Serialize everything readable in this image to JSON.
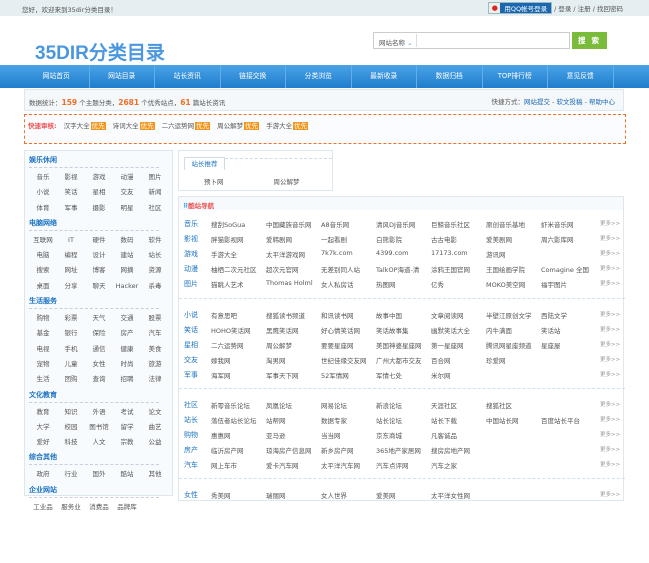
{
  "topbar": {
    "welcome": "您好，欢迎来到35dir分类目录！",
    "qq_login": "用QQ帐号登录",
    "links": "/ 登录 / 注册 / 找回密码"
  },
  "logo": "35DIR分类目录",
  "search": {
    "select": "网站名称",
    "button": "搜 索",
    "placeholder": ""
  },
  "nav": [
    "网站首页",
    "网站目录",
    "站长资讯",
    "链接交换",
    "分类浏览",
    "最新收录",
    "数据归档",
    "TOP排行榜",
    "意见反馈"
  ],
  "stats": {
    "prefix": "数据统计：",
    "categories": "159",
    "cat_text": "个主题分类，",
    "sites": "2681",
    "sites_text": "个优秀站点，",
    "news": "61",
    "news_text": "篇站长资讯",
    "quick_label": "快捷方式：",
    "quick_links": [
      "网站提交",
      "软文投稿",
      "帮助中心"
    ],
    "sep": " - "
  },
  "fast_review": {
    "title": "快速审核:",
    "tag": "优先",
    "items": [
      "汉字大全",
      "诗词大全",
      "二六运势网",
      "周公解梦",
      "手游大全"
    ]
  },
  "sidebar": [
    {
      "title": "娱乐休闲",
      "items": [
        "音乐",
        "影视",
        "游戏",
        "动漫",
        "图片",
        "小说",
        "笑话",
        "星相",
        "交友",
        "新闻",
        "体育",
        "军事",
        "摄影",
        "明星",
        "社区"
      ]
    },
    {
      "title": "电脑网络",
      "items": [
        "互联网",
        "IT",
        "硬件",
        "数码",
        "软件",
        "电脑",
        "编程",
        "设计",
        "建站",
        "站长",
        "搜索",
        "网址",
        "博客",
        "网摘",
        "资源",
        "桌面",
        "分享",
        "聊天",
        "Hacker",
        "杀毒"
      ]
    },
    {
      "title": "生活服务",
      "items": [
        "购物",
        "彩票",
        "天气",
        "交通",
        "股票",
        "基金",
        "银行",
        "保险",
        "房产",
        "汽车",
        "电视",
        "手机",
        "通信",
        "健康",
        "美食",
        "宠物",
        "儿童",
        "女性",
        "时尚",
        "旅游",
        "生活",
        "团购",
        "查询",
        "招聘",
        "法律"
      ]
    },
    {
      "title": "文化教育",
      "items": [
        "教育",
        "知识",
        "外语",
        "考试",
        "论文",
        "大学",
        "校园",
        "图书馆",
        "留学",
        "曲艺",
        "爱好",
        "科技",
        "人文",
        "宗教",
        "公益"
      ]
    },
    {
      "title": "综合其他",
      "items": [
        "政府",
        "行业",
        "国外",
        "酷站",
        "其他"
      ]
    },
    {
      "title": "企业网站",
      "items": [
        "工业品",
        "服务业",
        "消费品",
        "品牌库"
      ]
    }
  ],
  "recommend": {
    "title": "站长推荐",
    "items": [
      "预卜网",
      "周公解梦"
    ]
  },
  "site_nav": {
    "title": "酷站导航",
    "more": "更多>>",
    "groups": [
      [
        {
          "label": "音乐",
          "sites": [
            "搜刮SoGua",
            "中国藏族音乐网",
            "A8音乐网",
            "清风DJ音乐网",
            "巨鲸音乐社区",
            "原创音乐基地",
            "虾米音乐网"
          ]
        },
        {
          "label": "影视",
          "sites": [
            "胖猫影视网",
            "爱韩剧网",
            "一起看剧",
            "白熊影院",
            "古古电影",
            "爱美剧网",
            "周六影库网"
          ]
        },
        {
          "label": "游戏",
          "sites": [
            "手游大全",
            "太平洋游戏网",
            "7k7k.com",
            "4399.com",
            "17173.com",
            "游讯网"
          ]
        },
        {
          "label": "动漫",
          "sites": [
            "柚栖二次元社区",
            "超次元官网",
            "无差别同人站",
            "TalkOP海道-清",
            "涂鸦王国官网",
            "王国绘画学院",
            "Comagine 全国"
          ]
        },
        {
          "label": "图片",
          "sites": [
            "猫眺人艺术",
            "Thomas Holml",
            "女人私房话",
            "热图网",
            "亿秀",
            "MOKO美空网",
            "福宇图片"
          ]
        }
      ],
      [
        {
          "label": "小说",
          "sites": [
            "有意思吧",
            "搜狐读书频道",
            "和讯读书网",
            "故事中国",
            "文章阅读网",
            "半壁江原创文学",
            "西陆文学"
          ]
        },
        {
          "label": "笑话",
          "sites": [
            "HOHO笑话网",
            "黑鹰笑话网",
            "好心情笑话网",
            "笑话故事集",
            "幽默笑话大全",
            "内牛满面",
            "笑话站"
          ]
        },
        {
          "label": "星相",
          "sites": [
            "二六运势网",
            "周公解梦",
            "要要星座网",
            "美国神婆星座网",
            "第一星座网",
            "腾讯网星座频道",
            "星座屋"
          ]
        },
        {
          "label": "交友",
          "sites": [
            "嫁我网",
            "淘男网",
            "世纪佳缘交友网",
            "广州大都市交友",
            "百合网",
            "珍爱网"
          ]
        },
        {
          "label": "军事",
          "sites": [
            "海军网",
            "军事天下网",
            "52军情网",
            "军情七处",
            "米尔网"
          ]
        }
      ],
      [
        {
          "label": "社区",
          "sites": [
            "新零音乐论坛",
            "凤凰论坛",
            "网易论坛",
            "新浪论坛",
            "天涯社区",
            "搜狐社区"
          ]
        },
        {
          "label": "站长",
          "sites": [
            "落伍者站长论坛",
            "站帮网",
            "数据专家",
            "站长论坛",
            "站长下载",
            "中国站长网",
            "百度站长平台"
          ]
        },
        {
          "label": "购物",
          "sites": [
            "惠惠网",
            "亚马逊",
            "当当网",
            "京东商城",
            "凡客诚品"
          ]
        },
        {
          "label": "房产",
          "sites": [
            "临沂房产网",
            "琼海房产信息网",
            "新乡房产网",
            "365地产家居网",
            "搜房房地产网"
          ]
        },
        {
          "label": "汽车",
          "sites": [
            "网上车市",
            "爱卡汽车网",
            "太平洋汽车网",
            "汽车点评网",
            "汽车之家"
          ]
        }
      ],
      [
        {
          "label": "女性",
          "sites": [
            "秀美网",
            "瑞丽网",
            "女人世界",
            "爱美网",
            "太平洋女性网"
          ]
        }
      ]
    ]
  }
}
